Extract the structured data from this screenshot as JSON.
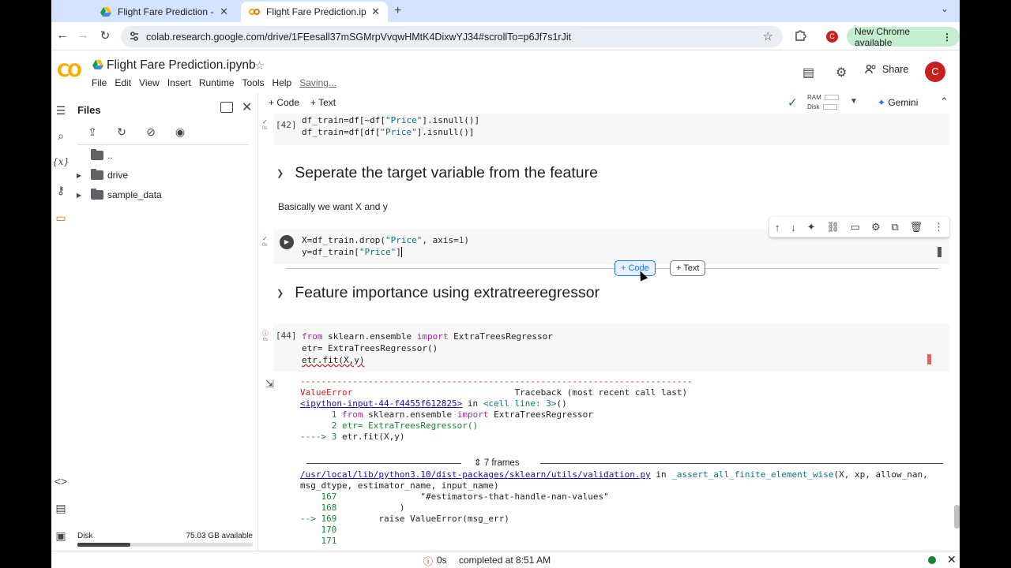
{
  "browser": {
    "tabs": [
      {
        "title": "Flight Fare Prediction - Googl",
        "icon": "google-drive-icon",
        "close": "✕"
      },
      {
        "title": "Flight Fare Prediction.ipynb -",
        "icon": "colab-icon",
        "close": "✕"
      }
    ],
    "new_tab": "+",
    "url": "colab.research.google.com/drive/1FEesall37mSGMrpVvqwHMtK4DixwYJ34#scrollTo=p6Jf7s1rJit",
    "new_chrome": "New Chrome available",
    "profile_initial": "C"
  },
  "colab": {
    "logo": "CO",
    "notebook_title": "Flight Fare Prediction.ipynb",
    "menu": [
      "File",
      "Edit",
      "View",
      "Insert",
      "Runtime",
      "Tools",
      "Help"
    ],
    "saving": "Saving...",
    "share": "Share",
    "avatar": "C"
  },
  "files_panel": {
    "title": "Files",
    "items": [
      {
        "name": ".."
      },
      {
        "name": "drive"
      },
      {
        "name": "sample_data"
      }
    ],
    "disk_label": "Disk",
    "disk_available": "75.03 GB available",
    "disk_used_fraction": 0.3
  },
  "nb_toolbar": {
    "add_code": "+ Code",
    "add_text": "+ Text",
    "ram": "RAM",
    "disk": "Disk",
    "gemini": "Gemini"
  },
  "cells": {
    "c42": {
      "exec": "[42]",
      "time": "0s"
    },
    "section1": "Seperate the target variable from the feature",
    "para1": "Basically we want X and y",
    "c43": {
      "time": "0s"
    },
    "insert_code": "+ Code",
    "insert_text": "+ Text",
    "section2": "Feature importance using extratreeregressor",
    "c44": {
      "exec": "[44]",
      "time": "0s"
    }
  },
  "traceback": {
    "dashes": "---------------------------------------------------------------------------",
    "error_type": "ValueError",
    "traceback_header": "Traceback (most recent call last)",
    "input_link": "<ipython-input-44-f4455f612825>",
    "in_text": " in ",
    "cell_line": "<cell line: 3>",
    "cell_suffix": "()",
    "l1_num": "      1 ",
    "l1_from": "from",
    "l1_mid": " sklearn.ensemble ",
    "l1_import": "import",
    "l1_end": " ExtraTreesRegressor",
    "l2": "      2 etr= ExtraTreesRegressor()",
    "l3_arrow": "----> 3 ",
    "l3": "etr.fit(X,y)",
    "frames": "7 frames",
    "path_link": "/usr/local/lib/python3.10/dist-packages/sklearn/utils/validation.py",
    "path_in": " in ",
    "func": "_assert_all_finite_element_wise",
    "func_args": "(X, xp, allow_nan,",
    "func_args2": "msg_dtype, estimator_name, input_name)",
    "t167_num": "    167",
    "t167": "                \"#estimators-that-handle-nan-values\"",
    "t168_num": "    168",
    "t168": "            )",
    "t169_arrow": "--> 169",
    "t169": "        raise ValueError(msg_err)",
    "t170": "    170",
    "t171": "    171"
  },
  "status": {
    "time": "0s",
    "completed": "completed at 8:51 AM"
  },
  "colors": {
    "accent": "#1a73e8",
    "ok": "#188038",
    "error": "#c5221f"
  }
}
